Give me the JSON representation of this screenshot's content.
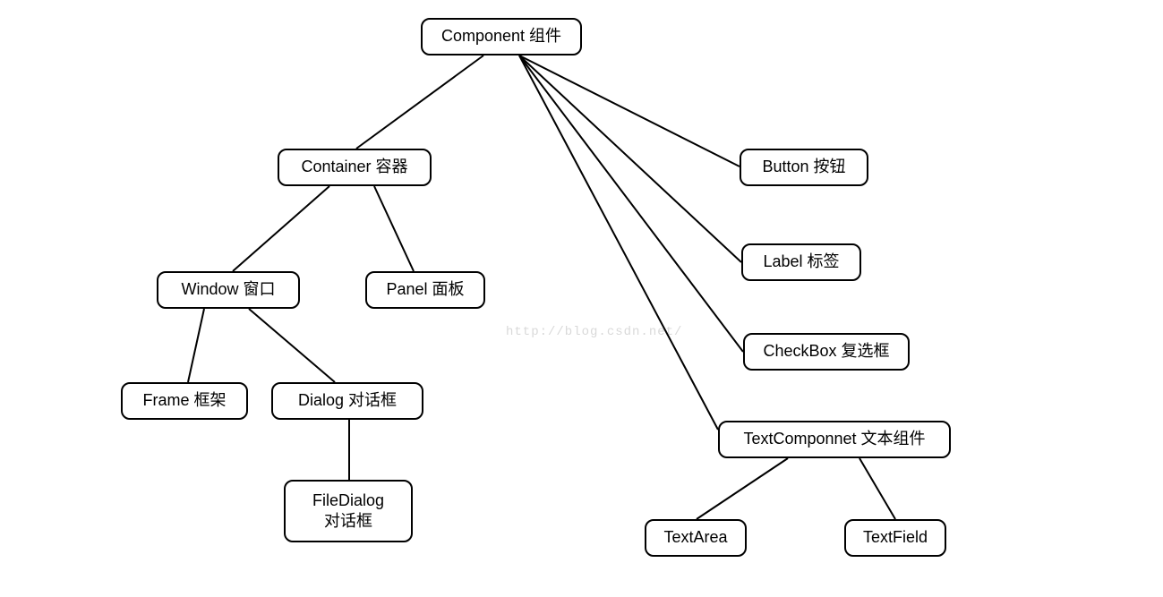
{
  "nodes": {
    "component": {
      "label": "Component 组件"
    },
    "container": {
      "label": "Container 容器"
    },
    "window": {
      "label": "Window 窗口"
    },
    "panel": {
      "label": "Panel 面板"
    },
    "frame": {
      "label": "Frame 框架"
    },
    "dialog": {
      "label": "Dialog 对话框"
    },
    "filedialog": {
      "label": "FileDialog\n对话框"
    },
    "button": {
      "label": "Button 按钮"
    },
    "label": {
      "label": "Label 标签"
    },
    "checkbox": {
      "label": "CheckBox 复选框"
    },
    "textcomponent": {
      "label": "TextComponnet 文本组件"
    },
    "textarea": {
      "label": "TextArea"
    },
    "textfield": {
      "label": "TextField"
    }
  },
  "watermark": "http://blog.csdn.net/"
}
